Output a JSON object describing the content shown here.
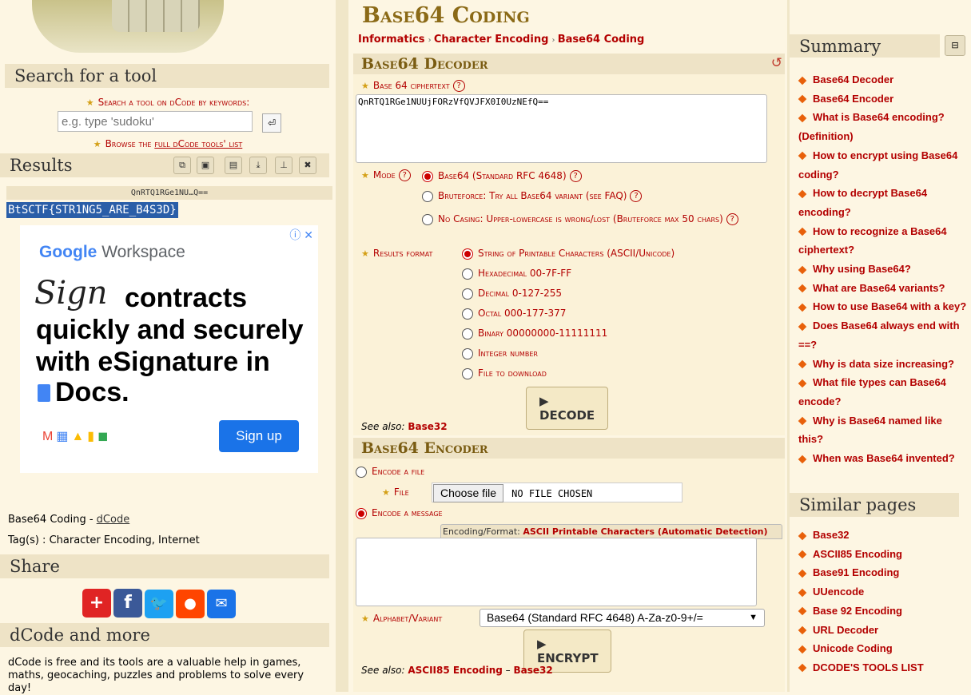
{
  "left": {
    "search_title": "Search for a tool",
    "search_label": "Search a tool on dCode by keywords:",
    "search_placeholder": "e.g. type 'sudoku'",
    "browse_prefix": "Browse the",
    "browse_link": "full dCode tools' list",
    "results_title": "Results",
    "results_input_short": "QnRTQ1RGe1NU…Q==",
    "results_output": "BtSCTF{STR1NG5_ARE_B4S3D}",
    "ad": {
      "brand_google": "Google",
      "brand_workspace": "Workspace",
      "sign_word": "Sign",
      "line1": "contracts",
      "line2": "quickly and securely",
      "line3": "with eSignature in",
      "line4": "Docs.",
      "cta": "Sign up"
    },
    "page_name": "Base64 Coding - ",
    "page_link": "dCode",
    "tags": "Tag(s) : Character Encoding, Internet",
    "share_title": "Share",
    "more_title": "dCode and more",
    "more_text": "dCode is free and its tools are a valuable help in games, maths, geocaching, puzzles and problems to solve every day!"
  },
  "main": {
    "title": "Base64 Coding",
    "breadcrumb": [
      "Informatics",
      "Character Encoding",
      "Base64 Coding"
    ],
    "decoder": {
      "title": "Base64 Decoder",
      "cipher_label": "Base 64 ciphertext",
      "cipher_value": "QnRTQ1RGe1NUUjFORzVfQVJFX0I0UzNEfQ==",
      "mode_label": "Mode",
      "modes": [
        "Base64 (Standard RFC 4648)",
        "Bruteforce: Try all Base64 variant (see FAQ)",
        "No Casing: Upper-lowercase is wrong/lost (Bruteforce max 50 chars)"
      ],
      "format_label": "Results format",
      "formats": [
        "String of Printable Characters (ASCII/Unicode)",
        "Hexadecimal 00-7F-FF",
        "Decimal 0-127-255",
        "Octal 000-177-377",
        "Binary 00000000-11111111",
        "Integer number",
        "File to download"
      ],
      "button": "DECODE",
      "see_also_label": "See also:",
      "see_also_link": "Base32"
    },
    "encoder": {
      "title": "Base64 Encoder",
      "encode_file": "Encode a file",
      "file_label": "File",
      "choose_file": "Choose file",
      "no_file": "NO FILE CHOSEN",
      "encode_message": "Encode a message",
      "format_prefix": "Encoding/Format:",
      "format_value": "ASCII Printable Characters (Automatic Detection)",
      "alphabet_label": "Alphabet/Variant",
      "alphabet_value": "Base64 (Standard RFC 4648) A-Za-z0-9+/=",
      "button": "ENCRYPT",
      "see_also_label": "See also:",
      "see_also_link1": "ASCII85 Encoding",
      "see_also_sep": " – ",
      "see_also_link2": "Base32"
    }
  },
  "right": {
    "summary_title": "Summary",
    "summary_items": [
      "Base64 Decoder",
      "Base64 Encoder",
      "What is Base64 encoding? (Definition)",
      "How to encrypt using Base64 coding?",
      "How to decrypt Base64 encoding?",
      "How to recognize a Base64 ciphertext?",
      "Why using Base64?",
      "What are Base64 variants?",
      "How to use Base64 with a key?",
      "Does Base64 always end with ==?",
      "Why is data size increasing?",
      "What file types can Base64 encode?",
      "Why is Base64 named like this?",
      "When was Base64 invented?"
    ],
    "similar_title": "Similar pages",
    "similar_items": [
      "Base32",
      "ASCII85 Encoding",
      "Base91 Encoding",
      "UUencode",
      "Base 92 Encoding",
      "URL Decoder",
      "Unicode Coding",
      "DCODE'S TOOLS LIST"
    ]
  }
}
